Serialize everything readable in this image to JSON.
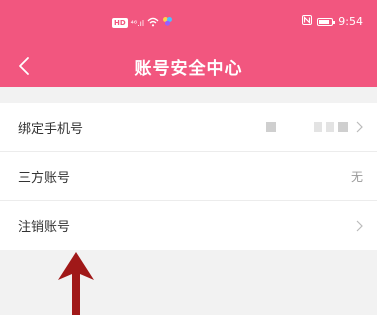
{
  "status_bar": {
    "left_badges": "HD",
    "signal": "⁴⁶.ıl",
    "time": "9:54",
    "battery_level_percent": 85
  },
  "header": {
    "title": "账号安全中心",
    "back_icon": "chevron-left-icon"
  },
  "colors": {
    "header_bg": "#f2567f",
    "page_bg": "#f2f2f2",
    "annotation_arrow": "#a01818"
  },
  "settings": {
    "items": [
      {
        "label": "绑定手机号",
        "value": "",
        "has_chevron": true
      },
      {
        "label": "三方账号",
        "value": "无",
        "has_chevron": false
      },
      {
        "label": "注销账号",
        "value": "",
        "has_chevron": true
      }
    ]
  }
}
